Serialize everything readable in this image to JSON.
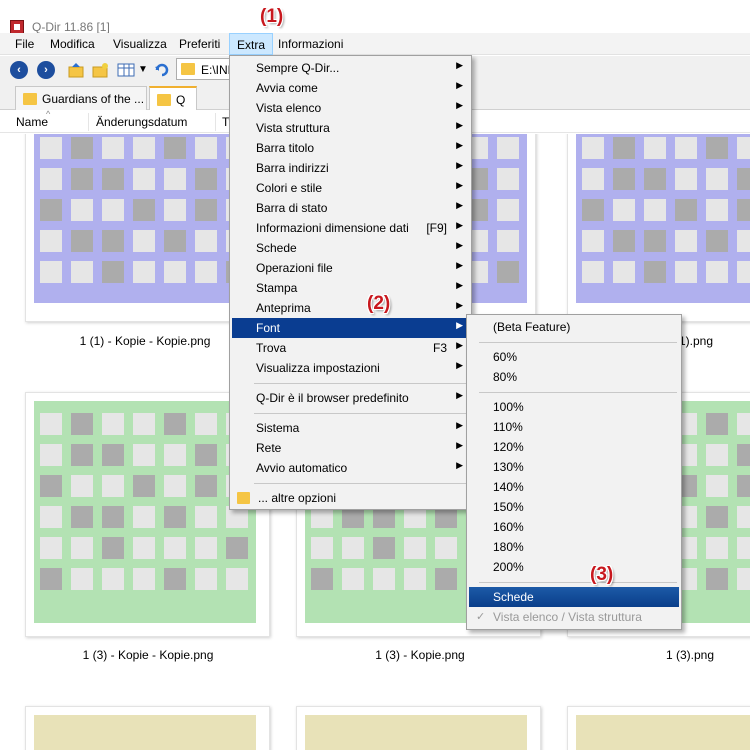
{
  "window": {
    "title": "Q-Dir 11.86 [1]"
  },
  "callouts": [
    "(1)",
    "(2)",
    "(3)"
  ],
  "menubar": {
    "items": [
      {
        "label": "File"
      },
      {
        "label": "Modifica"
      },
      {
        "label": "Visualizza"
      },
      {
        "label": "Preferiti"
      },
      {
        "label": "Extra"
      },
      {
        "label": "Informazioni"
      }
    ]
  },
  "toolbar": {
    "icons": [
      "back-icon",
      "forward-icon",
      "up-folder-icon",
      "new-folder-icon",
      "view-grid-icon",
      "dropdown-icon",
      "refresh-icon"
    ],
    "address": "E:\\INE"
  },
  "tabs": [
    {
      "label": "Guardians of the ..."
    },
    {
      "label": "Q"
    }
  ],
  "columns": [
    "Name",
    "Änderungsdatum",
    "Ty"
  ],
  "files": [
    {
      "caption": "1 (1) - Kopie - Kopie.png",
      "color": "#b0b0ee"
    },
    {
      "caption": "",
      "color": "#b0b0ee"
    },
    {
      "caption": "1).png",
      "color": "#b0b0ee"
    },
    {
      "caption": "1 (3) - Kopie - Kopie.png",
      "color": "#b3e2b3"
    },
    {
      "caption": "1 (3) - Kopie.png",
      "color": "#b3e2b3"
    },
    {
      "caption": "1 (3).png",
      "color": "#b3e2b3"
    },
    {
      "caption": "",
      "color": "#e8e2b8"
    },
    {
      "caption": "",
      "color": "#e8e2b8"
    },
    {
      "caption": "",
      "color": "#e8e2b8"
    }
  ],
  "extra_menu": {
    "items": [
      {
        "label": "Sempre Q-Dir...",
        "submenu": true
      },
      {
        "label": "Avvia come",
        "submenu": true
      },
      {
        "label": "Vista elenco",
        "submenu": true
      },
      {
        "label": "Vista struttura",
        "submenu": true
      },
      {
        "label": "Barra titolo",
        "submenu": true
      },
      {
        "label": "Barra indirizzi",
        "submenu": true
      },
      {
        "label": "Colori e stile",
        "submenu": true
      },
      {
        "label": "Barra di stato",
        "submenu": true
      },
      {
        "label": "Informazioni dimensione dati",
        "shortcut": "[F9]",
        "submenu": true
      },
      {
        "label": "Schede",
        "submenu": true
      },
      {
        "label": "Operazioni file",
        "submenu": true
      },
      {
        "label": "Stampa",
        "submenu": true
      },
      {
        "label": "Anteprima",
        "submenu": true
      },
      {
        "label": "Font",
        "submenu": true,
        "highlighted": true
      },
      {
        "label": "Trova",
        "shortcut": "F3",
        "submenu": true
      },
      {
        "label": "Visualizza impostazioni",
        "submenu": true
      },
      {
        "label": "Q-Dir è il browser predefinito",
        "submenu": true
      },
      {
        "label": "Sistema",
        "submenu": true
      },
      {
        "label": "Rete",
        "submenu": true
      },
      {
        "label": "Avvio automatico",
        "submenu": true
      },
      {
        "label": "... altre opzioni",
        "icon": "folder-icon"
      }
    ]
  },
  "font_submenu": {
    "items": [
      {
        "label": "(Beta Feature)"
      },
      {
        "label": "60%"
      },
      {
        "label": "80%"
      },
      {
        "label": "100%"
      },
      {
        "label": "110%"
      },
      {
        "label": "120%"
      },
      {
        "label": "130%"
      },
      {
        "label": "140%"
      },
      {
        "label": "150%"
      },
      {
        "label": "160%"
      },
      {
        "label": "180%"
      },
      {
        "label": "200%"
      },
      {
        "label": "Schede",
        "highlighted": true
      },
      {
        "label": "Vista elenco / Vista struttura",
        "disabled": true,
        "checked": true
      }
    ]
  },
  "colors": {
    "menu_highlight": "#0a3d91",
    "callout": "#c8181e",
    "folder": "#f5c544"
  }
}
